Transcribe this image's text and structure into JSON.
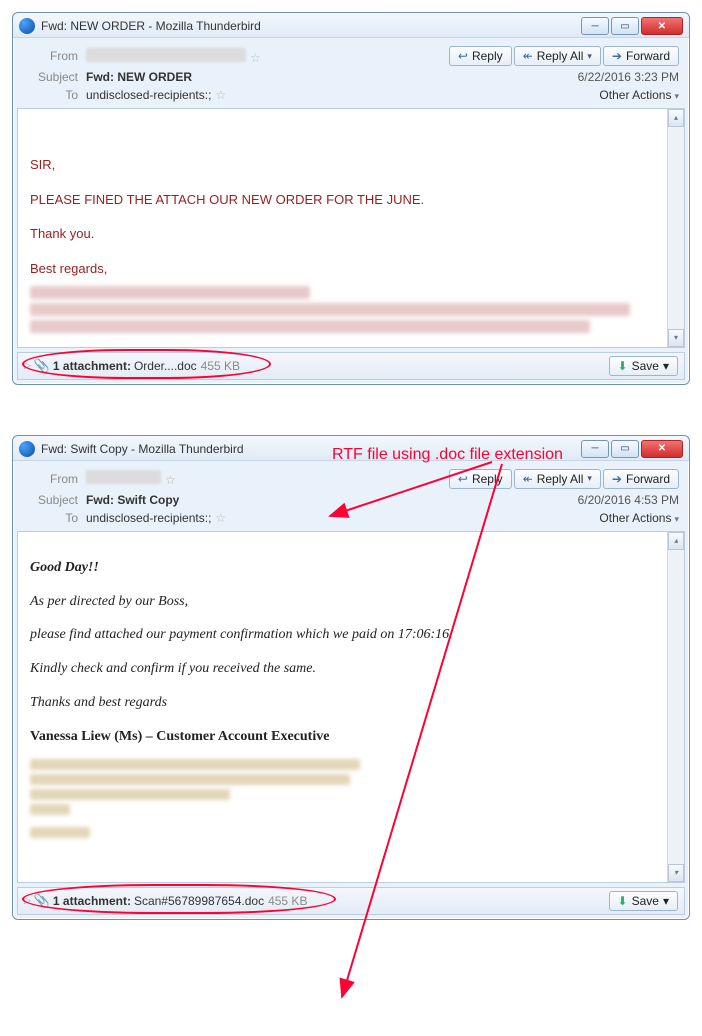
{
  "annotation": "RTF file using .doc file extension",
  "buttons": {
    "reply": "Reply",
    "reply_all": "Reply All",
    "forward": "Forward",
    "save": "Save",
    "other_actions": "Other Actions"
  },
  "labels": {
    "from": "From",
    "subject": "Subject",
    "to": "To"
  },
  "windows": [
    {
      "title": "Fwd: NEW ORDER - Mozilla Thunderbird",
      "subject": "Fwd: NEW ORDER",
      "to": "undisclosed-recipients:;",
      "date": "6/22/2016 3:23 PM",
      "body_style": "red",
      "body_lines": [
        "SIR,",
        "PLEASE FINED THE ATTACH OUR NEW ORDER FOR  THE JUNE.",
        "Thank you.",
        "Best regards,"
      ],
      "attachment": {
        "label": "1 attachment:",
        "file": "Order....doc",
        "size": "455 KB"
      }
    },
    {
      "title": "Fwd: Swift Copy - Mozilla Thunderbird",
      "subject": "Fwd: Swift Copy",
      "to": "undisclosed-recipients:;",
      "date": "6/20/2016 4:53 PM",
      "body_style": "serif",
      "body_lines": [
        "Good Day!!",
        "As per directed by our Boss,",
        "please find attached our payment confirmation which we paid on 17:06:16.",
        "Kindly check and confirm if you received the same.",
        "Thanks and best regards",
        "Vanessa Liew (Ms) – Customer Account Executive"
      ],
      "attachment": {
        "label": "1 attachment:",
        "file": "Scan#56789987654.doc",
        "size": "455 KB"
      }
    }
  ]
}
